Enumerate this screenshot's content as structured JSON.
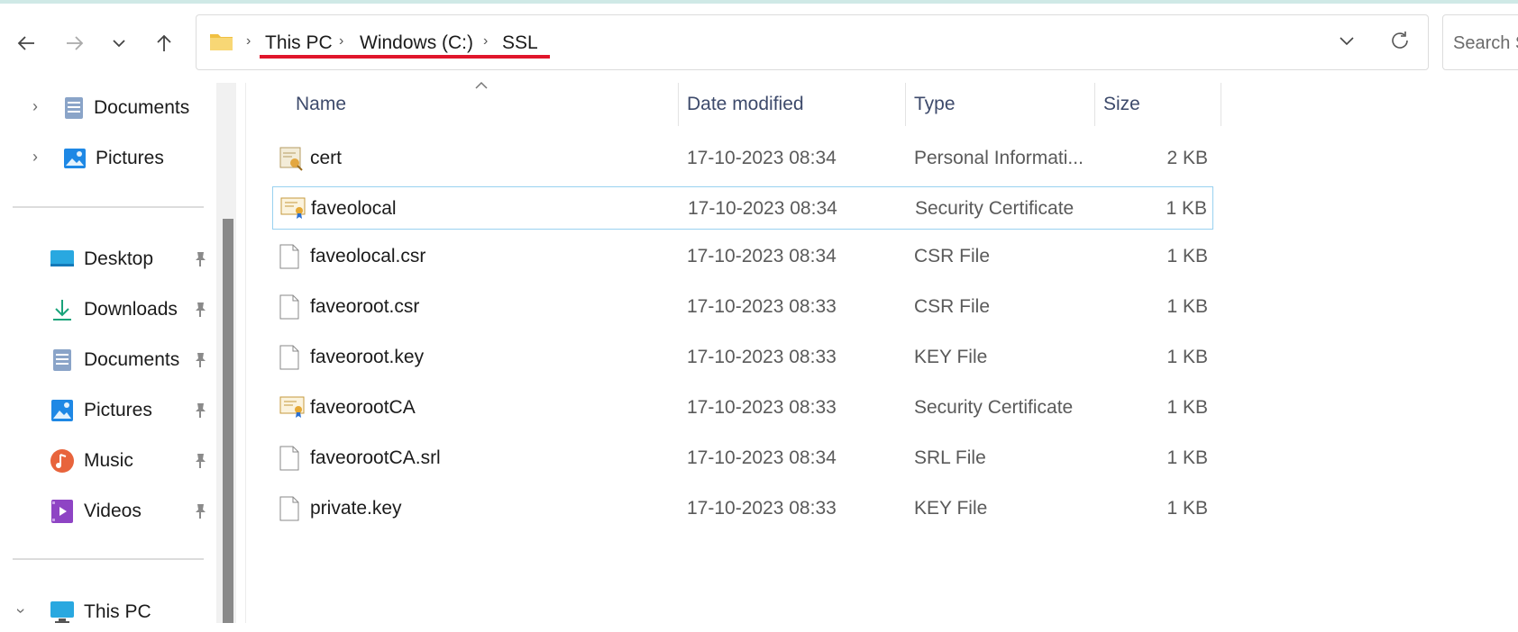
{
  "toolbar": {
    "back_icon": "arrow-left-icon",
    "forward_icon": "arrow-right-icon",
    "recent_icon": "chevron-down-icon",
    "up_icon": "arrow-up-icon",
    "breadcrumb": [
      "This PC",
      "Windows (C:)",
      "SSL"
    ],
    "search_placeholder": "Search S"
  },
  "nav": {
    "top_items": [
      {
        "label": "Documents",
        "icon": "documents-icon"
      },
      {
        "label": "Pictures",
        "icon": "pictures-icon"
      }
    ],
    "quick_access": [
      {
        "label": "Desktop",
        "icon": "desktop-icon"
      },
      {
        "label": "Downloads",
        "icon": "downloads-icon"
      },
      {
        "label": "Documents",
        "icon": "documents-icon"
      },
      {
        "label": "Pictures",
        "icon": "pictures-icon"
      },
      {
        "label": "Music",
        "icon": "music-icon"
      },
      {
        "label": "Videos",
        "icon": "videos-icon"
      }
    ],
    "this_pc": {
      "label": "This PC",
      "icon": "this-pc-icon"
    }
  },
  "columns": {
    "name": "Name",
    "date": "Date modified",
    "type": "Type",
    "size": "Size"
  },
  "files": [
    {
      "name": "cert",
      "date": "17-10-2023 08:34",
      "type": "Personal Informati...",
      "size": "2 KB",
      "icon": "pfx-icon"
    },
    {
      "name": "faveolocal",
      "date": "17-10-2023 08:34",
      "type": "Security Certificate",
      "size": "1 KB",
      "icon": "certificate-icon",
      "selected": true
    },
    {
      "name": "faveolocal.csr",
      "date": "17-10-2023 08:34",
      "type": "CSR File",
      "size": "1 KB",
      "icon": "file-icon"
    },
    {
      "name": "faveoroot.csr",
      "date": "17-10-2023 08:33",
      "type": "CSR File",
      "size": "1 KB",
      "icon": "file-icon"
    },
    {
      "name": "faveoroot.key",
      "date": "17-10-2023 08:33",
      "type": "KEY File",
      "size": "1 KB",
      "icon": "file-icon"
    },
    {
      "name": "faveorootCA",
      "date": "17-10-2023 08:33",
      "type": "Security Certificate",
      "size": "1 KB",
      "icon": "certificate-icon"
    },
    {
      "name": "faveorootCA.srl",
      "date": "17-10-2023 08:34",
      "type": "SRL File",
      "size": "1 KB",
      "icon": "file-icon"
    },
    {
      "name": "private.key",
      "date": "17-10-2023 08:33",
      "type": "KEY File",
      "size": "1 KB",
      "icon": "file-icon"
    }
  ],
  "colors": {
    "accent_underline": "#e0162b",
    "selection_border": "#99d1f0",
    "header_text": "#3d4a6b"
  }
}
